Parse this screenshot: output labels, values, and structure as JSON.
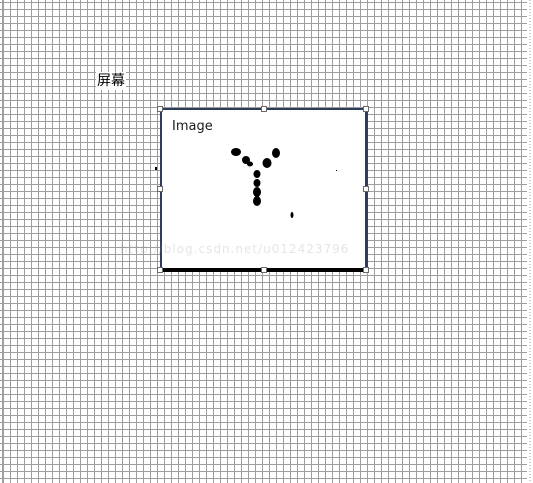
{
  "designer": {
    "screen_label": "屏幕"
  },
  "image_control": {
    "caption": "Image",
    "border_color": "#2d3e5a",
    "content_icon": "letter-y-drawing"
  },
  "watermark": {
    "text": "http://blog.csdn.net/u012423796"
  }
}
